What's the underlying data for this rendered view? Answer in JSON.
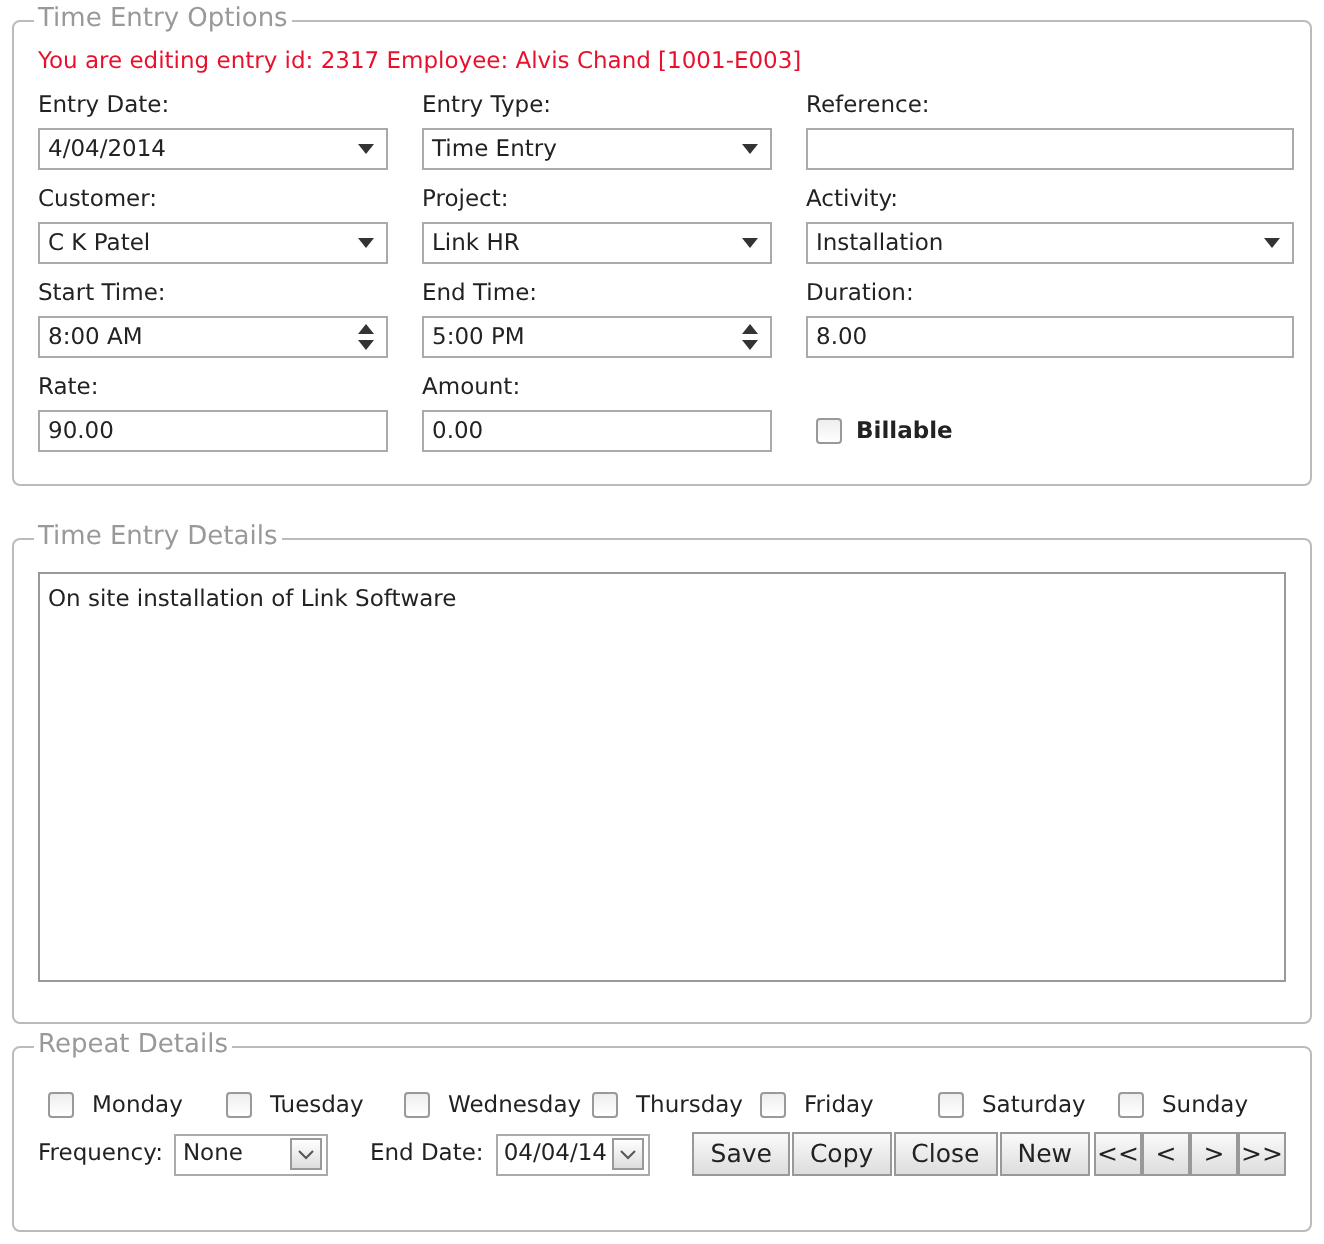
{
  "options": {
    "legend": "Time Entry Options",
    "notice": "You are editing entry id: 2317 Employee: Alvis Chand [1001-E003]",
    "fields": [
      {
        "kind": "select",
        "label": "Entry Date:",
        "value": "4/04/2014"
      },
      {
        "kind": "select",
        "label": "Entry Type:",
        "value": "Time Entry"
      },
      {
        "kind": "text",
        "label": "Reference:"
      },
      {
        "kind": "select",
        "label": "Customer:",
        "value": "C K Patel"
      },
      {
        "kind": "select",
        "label": "Project:",
        "value": "Link HR"
      },
      {
        "kind": "select",
        "label": "Activity:",
        "value": "Installation"
      },
      {
        "kind": "spinner",
        "label": "Start Time:",
        "value": "8:00 AM"
      },
      {
        "kind": "spinner",
        "label": "End Time:",
        "value": "5:00 PM"
      },
      {
        "kind": "text",
        "label": "Duration:",
        "value": "8.00"
      },
      {
        "kind": "text",
        "label": "Rate:",
        "value": "90.00"
      },
      {
        "kind": "text",
        "label": "Amount:",
        "value": "0.00"
      },
      {
        "kind": "checkbox",
        "label": "Billable",
        "checked": false
      }
    ]
  },
  "details": {
    "legend": "Time Entry Details",
    "text": "On site installation of Link Software"
  },
  "repeat": {
    "legend": "Repeat Details",
    "days": [
      {
        "label": "Monday",
        "checked": false
      },
      {
        "label": "Tuesday",
        "checked": false
      },
      {
        "label": "Wednesday",
        "checked": false
      },
      {
        "label": "Thursday",
        "checked": false
      },
      {
        "label": "Friday",
        "checked": false
      },
      {
        "label": "Saturday",
        "checked": false
      },
      {
        "label": "Sunday",
        "checked": false
      }
    ],
    "frequency": {
      "label": "Frequency:",
      "value": "None"
    },
    "end_date": {
      "label": "End Date:",
      "value": "04/04/14"
    },
    "buttons": [
      "Save",
      "Copy",
      "Close",
      "New"
    ],
    "nav_buttons": [
      "<<",
      "<",
      ">",
      ">>"
    ]
  }
}
